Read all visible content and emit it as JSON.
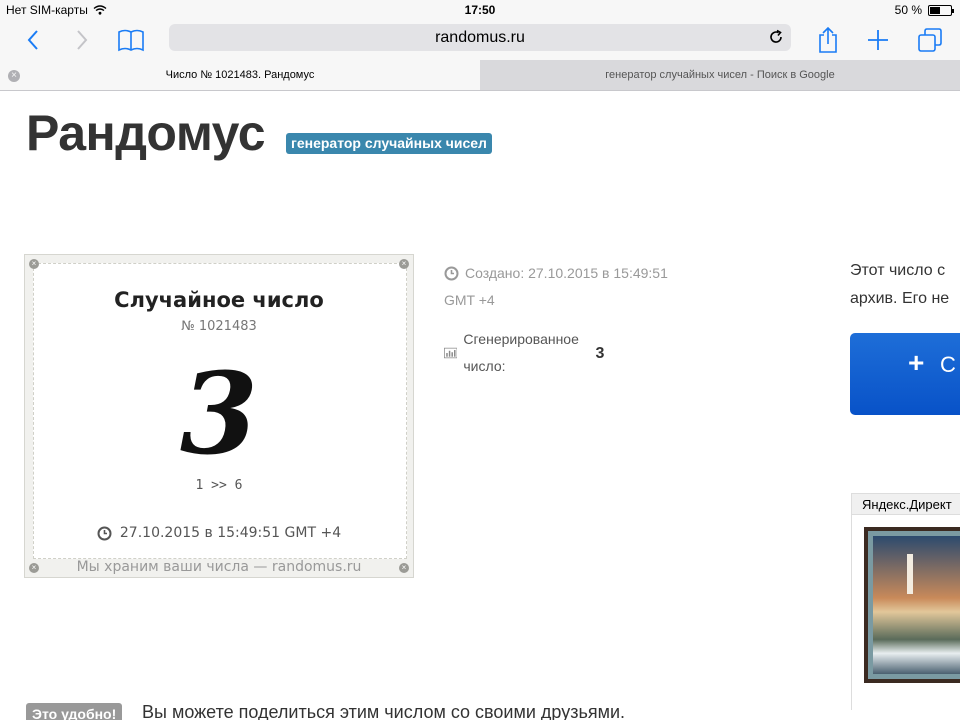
{
  "status": {
    "carrier": "Нет SIM-карты",
    "time": "17:50",
    "battery": "50 %",
    "battery_level": 0.5
  },
  "toolbar": {
    "url": "randomus.ru"
  },
  "tabs": [
    {
      "title": "Число № 1021483. Рандомус"
    },
    {
      "title": "генератор случайных чисел - Поиск в Google"
    }
  ],
  "site": {
    "brand": "Рандомус",
    "tagline": "генератор случайных чисел"
  },
  "card": {
    "title": "Случайное число",
    "number": "№ 1021483",
    "value": "3",
    "range": "1 >> 6",
    "date": "27.10.2015 в 15:49:51 GMT +4",
    "footer": "Мы храним ваши числа — randomus.ru"
  },
  "meta": {
    "created_line1": "Создано: 27.10.2015 в 15:49:51",
    "created_line2": "GMT +4",
    "generated_label": "Сгенерированное число:",
    "generated_value": "3"
  },
  "right": {
    "text_line1": "Этот число с",
    "text_line2": "архив. Его не",
    "button_label": "С",
    "ad_label": "Яндекс.Директ"
  },
  "bottom": {
    "badge": "Это удобно!",
    "text": "Вы можете поделиться этим числом со своими друзьями."
  },
  "colors": {
    "accent": "#1a7cf5",
    "badge": "#3a87ad",
    "button": "#0852c8"
  }
}
